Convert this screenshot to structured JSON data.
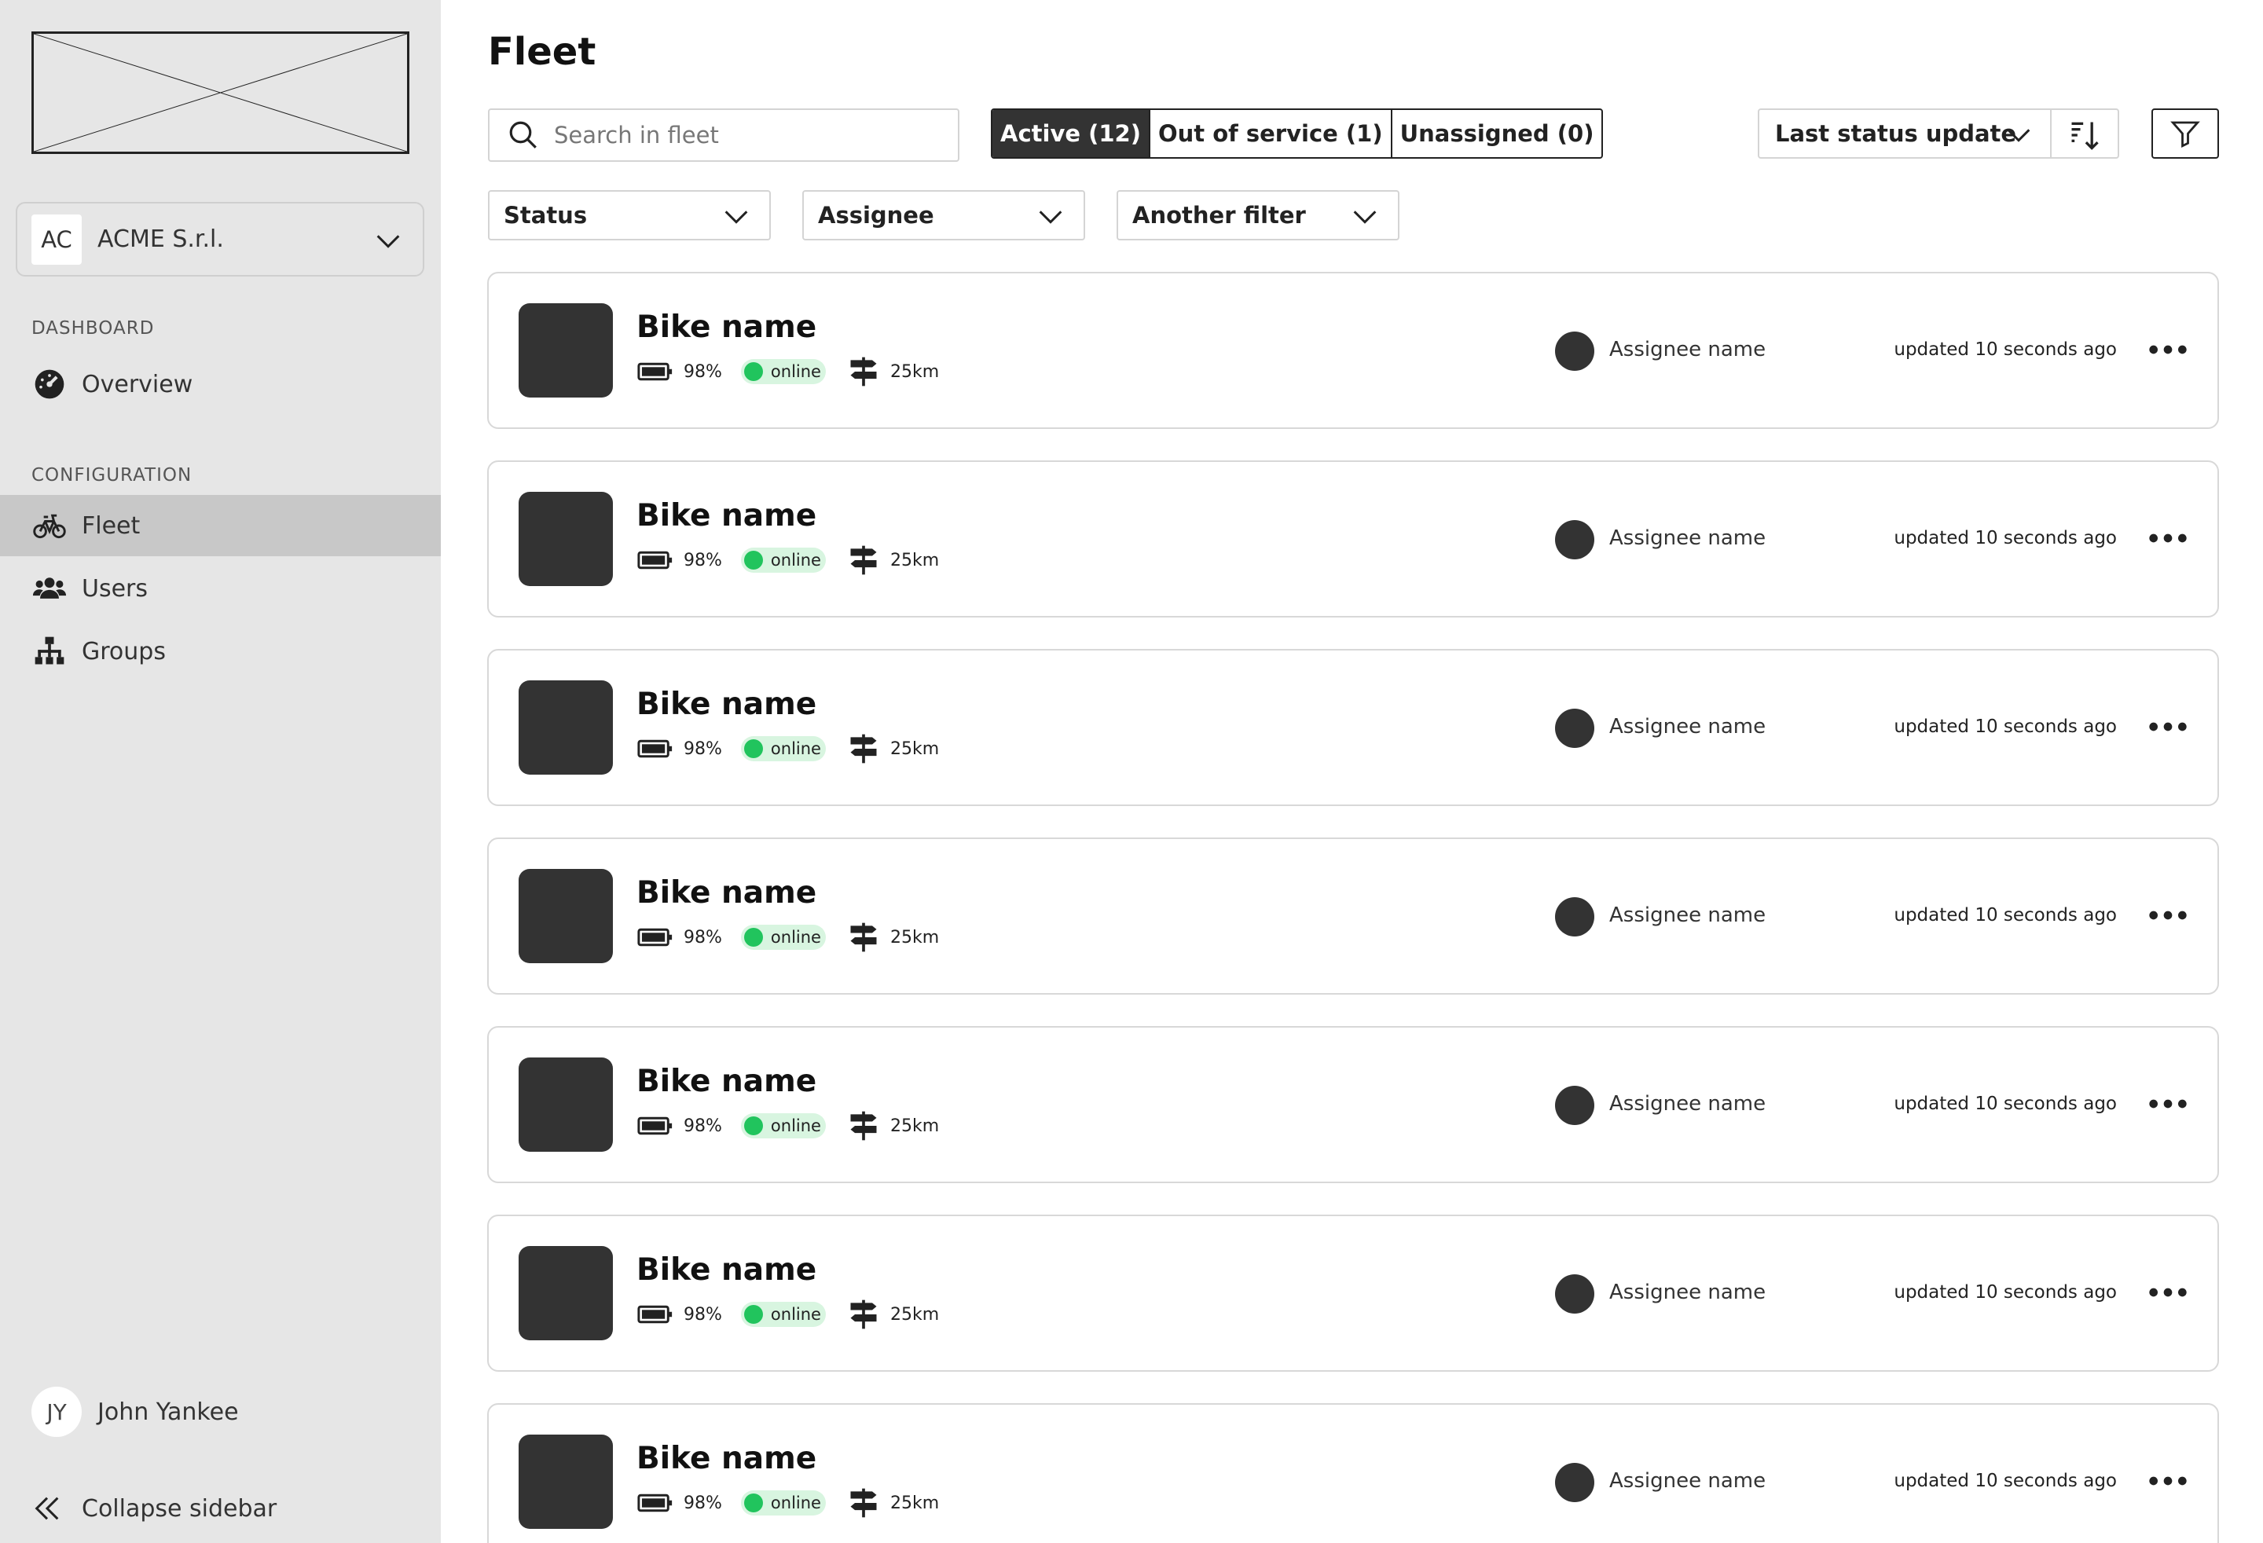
{
  "sidebar": {
    "org": {
      "initials": "AC",
      "name": "ACME S.r.l."
    },
    "sections": {
      "dashboard": "DASHBOARD",
      "configuration": "CONFIGURATION"
    },
    "nav": {
      "overview": "Overview",
      "fleet": "Fleet",
      "users": "Users",
      "groups": "Groups"
    },
    "active_item": "Fleet",
    "user": {
      "initials": "JY",
      "name": "John Yankee"
    },
    "collapse_label": "Collapse sidebar"
  },
  "main": {
    "title": "Fleet",
    "search_placeholder": "Search in fleet",
    "tabs": [
      {
        "label": "Active (12)",
        "selected": true
      },
      {
        "label": "Out of service (1)",
        "selected": false
      },
      {
        "label": "Unassigned (0)",
        "selected": false
      }
    ],
    "sort": {
      "label": "Last status update"
    },
    "filters": [
      "Status",
      "Assignee",
      "Another filter"
    ],
    "bikes": [
      {
        "name": "Bike name",
        "battery": "98%",
        "status": "online",
        "distance": "25km",
        "assignee": "Assignee name",
        "updated": "updated 10 seconds ago"
      },
      {
        "name": "Bike name",
        "battery": "98%",
        "status": "online",
        "distance": "25km",
        "assignee": "Assignee name",
        "updated": "updated 10 seconds ago"
      },
      {
        "name": "Bike name",
        "battery": "98%",
        "status": "online",
        "distance": "25km",
        "assignee": "Assignee name",
        "updated": "updated 10 seconds ago"
      },
      {
        "name": "Bike name",
        "battery": "98%",
        "status": "online",
        "distance": "25km",
        "assignee": "Assignee name",
        "updated": "updated 10 seconds ago"
      },
      {
        "name": "Bike name",
        "battery": "98%",
        "status": "online",
        "distance": "25km",
        "assignee": "Assignee name",
        "updated": "updated 10 seconds ago"
      },
      {
        "name": "Bike name",
        "battery": "98%",
        "status": "online",
        "distance": "25km",
        "assignee": "Assignee name",
        "updated": "updated 10 seconds ago"
      },
      {
        "name": "Bike name",
        "battery": "98%",
        "status": "online",
        "distance": "25km",
        "assignee": "Assignee name",
        "updated": "updated 10 seconds ago"
      }
    ]
  },
  "colors": {
    "sidebar_bg": "#e6e6e6",
    "active_nav": "#c8c8c8",
    "dark": "#333333",
    "online_dot": "#21c45d",
    "online_pill": "#d8f5e0"
  }
}
